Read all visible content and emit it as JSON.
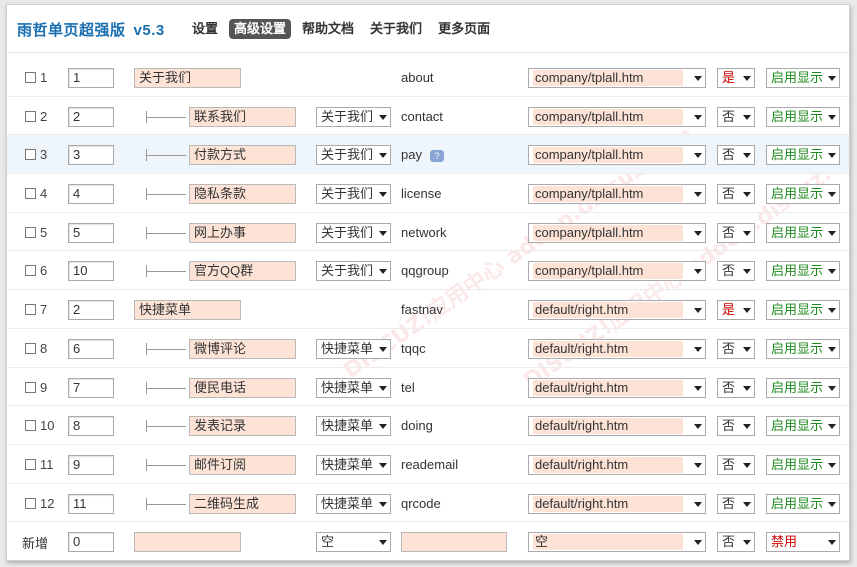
{
  "header": {
    "title": "雨哲单页超强版",
    "version": "v5.3",
    "nav": [
      "设置",
      "高级设置",
      "帮助文档",
      "关于我们",
      "更多页面"
    ],
    "active_nav": 1
  },
  "watermark_text": "DISCUZ!应用中心 addon.discuz.com",
  "rows": [
    {
      "index": "1",
      "order": "1",
      "name": "关于我们",
      "level": "top",
      "parent": "",
      "key": "about",
      "template": "company/tplall.htm",
      "show": "是",
      "status": "启用显示"
    },
    {
      "index": "2",
      "order": "2",
      "name": "联系我们",
      "level": "child",
      "parent": "关于我们",
      "key": "contact",
      "template": "company/tplall.htm",
      "show": "否",
      "status": "启用显示"
    },
    {
      "index": "3",
      "order": "3",
      "name": "付款方式",
      "level": "child",
      "parent": "关于我们",
      "key": "pay",
      "template": "company/tplall.htm",
      "show": "否",
      "status": "启用显示",
      "help": true
    },
    {
      "index": "4",
      "order": "4",
      "name": "隐私条款",
      "level": "child",
      "parent": "关于我们",
      "key": "license",
      "template": "company/tplall.htm",
      "show": "否",
      "status": "启用显示"
    },
    {
      "index": "5",
      "order": "5",
      "name": "网上办事",
      "level": "child",
      "parent": "关于我们",
      "key": "network",
      "template": "company/tplall.htm",
      "show": "否",
      "status": "启用显示"
    },
    {
      "index": "6",
      "order": "10",
      "name": "官方QQ群",
      "level": "child",
      "parent": "关于我们",
      "key": "qqgroup",
      "template": "company/tplall.htm",
      "show": "否",
      "status": "启用显示"
    },
    {
      "index": "7",
      "order": "2",
      "name": "快捷菜单",
      "level": "top",
      "parent": "",
      "key": "fastnav",
      "template": "default/right.htm",
      "show": "是",
      "status": "启用显示"
    },
    {
      "index": "8",
      "order": "6",
      "name": "微博评论",
      "level": "child",
      "parent": "快捷菜单",
      "key": "tqqc",
      "template": "default/right.htm",
      "show": "否",
      "status": "启用显示"
    },
    {
      "index": "9",
      "order": "7",
      "name": "便民电话",
      "level": "child",
      "parent": "快捷菜单",
      "key": "tel",
      "template": "default/right.htm",
      "show": "否",
      "status": "启用显示"
    },
    {
      "index": "10",
      "order": "8",
      "name": "发表记录",
      "level": "child",
      "parent": "快捷菜单",
      "key": "doing",
      "template": "default/right.htm",
      "show": "否",
      "status": "启用显示"
    },
    {
      "index": "11",
      "order": "9",
      "name": "邮件订阅",
      "level": "child",
      "parent": "快捷菜单",
      "key": "reademail",
      "template": "default/right.htm",
      "show": "否",
      "status": "启用显示"
    },
    {
      "index": "12",
      "order": "11",
      "name": "二维码生成",
      "level": "child",
      "parent": "快捷菜单",
      "key": "qrcode",
      "template": "default/right.htm",
      "show": "否",
      "status": "启用显示"
    }
  ],
  "new_row": {
    "label": "新增",
    "order": "0",
    "name": "",
    "parent": "空",
    "key": "",
    "template": "空",
    "show": "否",
    "status": "禁用"
  },
  "colors": {
    "accent": "#1a6fb0",
    "input_fill": "#fde3d6",
    "enabled": "#1d8a1d",
    "warn": "#cc0000"
  }
}
